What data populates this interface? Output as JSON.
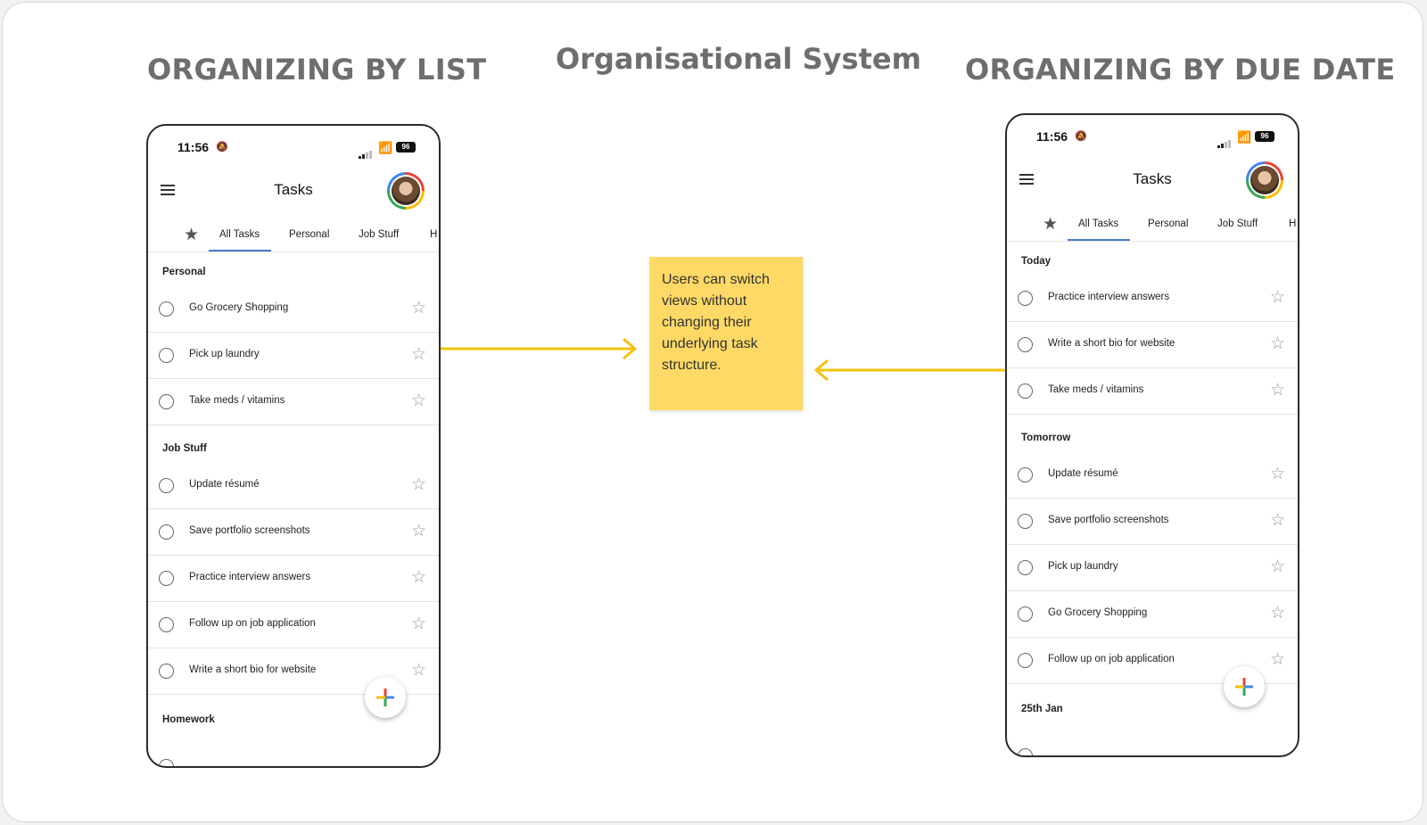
{
  "headings": {
    "left": "ORGANIZING BY LIST",
    "center": "Organisational System",
    "right": "ORGANIZING BY DUE DATE"
  },
  "sticky_note": "Users can switch views without changing their underlying task structure.",
  "colors": {
    "sticky": "#ffd966",
    "arrow": "#f4c20d",
    "tab_underline": "#4a7dc7"
  },
  "phone_left": {
    "time": "11:56",
    "battery": "96",
    "title": "Tasks",
    "tabs": [
      "All Tasks",
      "Personal",
      "Job Stuff",
      "H"
    ],
    "sections": [
      {
        "name": "Personal",
        "tasks": [
          "Go Grocery Shopping",
          "Pick up laundry",
          "Take meds / vitamins"
        ]
      },
      {
        "name": "Job Stuff",
        "tasks": [
          "Update résumé",
          "Save portfolio screenshots",
          "Practice interview answers",
          "Follow up on job application",
          "Write a short bio for website"
        ]
      },
      {
        "name": "Homework",
        "tasks": []
      }
    ]
  },
  "phone_right": {
    "time": "11:56",
    "battery": "96",
    "title": "Tasks",
    "tabs": [
      "All Tasks",
      "Personal",
      "Job Stuff",
      "H"
    ],
    "sections": [
      {
        "name": "Today",
        "tasks": [
          "Practice interview answers",
          "Write a short bio for website",
          "Take meds / vitamins"
        ]
      },
      {
        "name": "Tomorrow",
        "tasks": [
          "Update résumé",
          "Save portfolio screenshots",
          "Pick up laundry",
          "Go Grocery Shopping",
          "Follow up on job application"
        ]
      },
      {
        "name": "25th Jan",
        "tasks": []
      }
    ]
  }
}
